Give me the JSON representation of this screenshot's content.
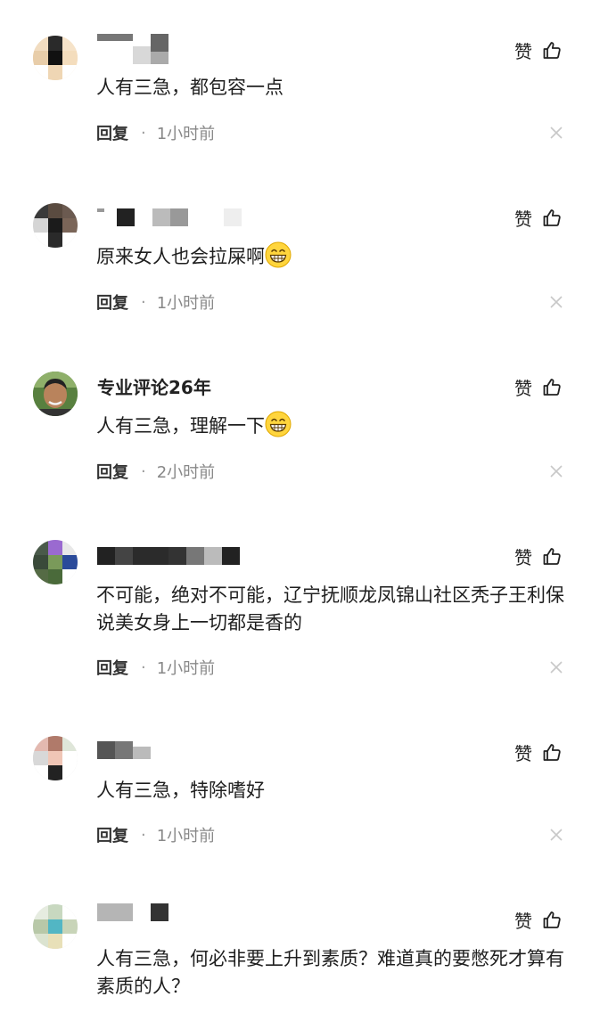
{
  "comments": [
    {
      "name": "",
      "text": "人有三急，都包容一点",
      "reply_label": "回复",
      "separator": "·",
      "time": "1小时前",
      "like_label": "赞",
      "icons": {
        "like": "thumbs-up-icon",
        "close": "close-icon"
      }
    },
    {
      "name": "",
      "text": "原来女人也会拉屎啊",
      "emoji": "grinning-face-emoji",
      "reply_label": "回复",
      "separator": "·",
      "time": "1小时前",
      "like_label": "赞",
      "icons": {
        "like": "thumbs-up-icon",
        "close": "close-icon"
      }
    },
    {
      "name": "专业评论26年",
      "text": "人有三急，理解一下",
      "emoji": "grinning-face-emoji",
      "reply_label": "回复",
      "separator": "·",
      "time": "2小时前",
      "like_label": "赞",
      "icons": {
        "like": "thumbs-up-icon",
        "close": "close-icon"
      }
    },
    {
      "name": "",
      "text": "不可能，绝对不可能，辽宁抚顺龙凤锦山社区秃子王利保说美女身上一切都是香的",
      "reply_label": "回复",
      "separator": "·",
      "time": "1小时前",
      "like_label": "赞",
      "icons": {
        "like": "thumbs-up-icon",
        "close": "close-icon"
      }
    },
    {
      "name": "",
      "text": "人有三急，特除嗜好",
      "reply_label": "回复",
      "separator": "·",
      "time": "1小时前",
      "like_label": "赞",
      "icons": {
        "like": "thumbs-up-icon",
        "close": "close-icon"
      }
    },
    {
      "name": "",
      "text": "人有三急，何必非要上升到素质？难道真的要憋死才算有素质的人？",
      "like_label": "赞",
      "icons": {
        "like": "thumbs-up-icon"
      }
    }
  ],
  "colors": {
    "text": "#1f1f1f",
    "meta": "#888888",
    "close": "#c8c8c8",
    "background": "#ffffff"
  }
}
